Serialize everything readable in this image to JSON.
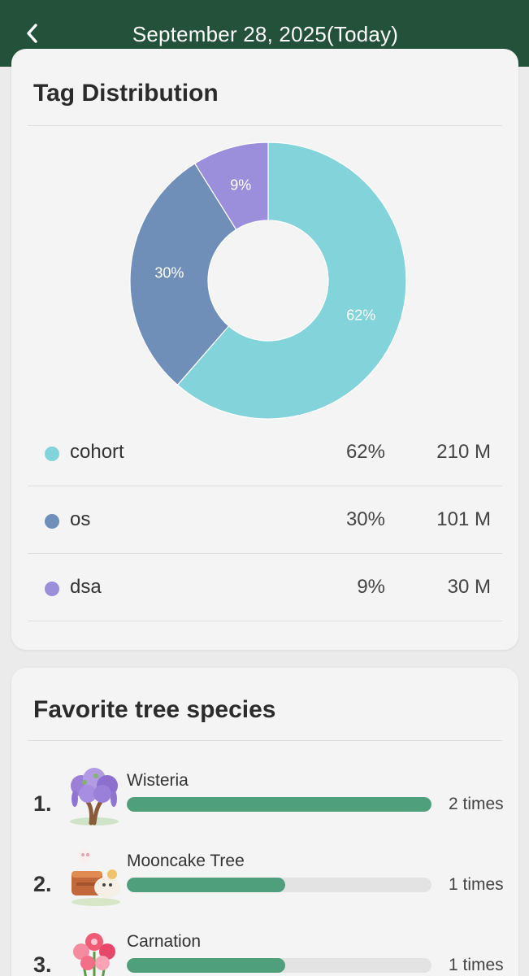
{
  "header": {
    "title": "September 28, 2025(Today)",
    "back_icon": "chevron-left-icon",
    "background": "#235139"
  },
  "tag_distribution": {
    "title": "Tag Distribution",
    "chart_data": {
      "type": "pie",
      "donut": true,
      "slices": [
        {
          "label": "cohort",
          "percent": 62,
          "display": "62%",
          "value": "210 M",
          "color": "#82d3da"
        },
        {
          "label": "os",
          "percent": 30,
          "display": "30%",
          "value": "101 M",
          "color": "#6f8fb9"
        },
        {
          "label": "dsa",
          "percent": 9,
          "display": "9%",
          "value": "30 M",
          "color": "#9b8edb"
        }
      ]
    }
  },
  "favorites": {
    "title": "Favorite tree species",
    "max_count": 2,
    "bar_color": "#4f9f7d",
    "items": [
      {
        "rank": "1.",
        "name": "Wisteria",
        "count": 2,
        "times": "2 times",
        "icon": "wisteria-tree-icon"
      },
      {
        "rank": "2.",
        "name": "Mooncake Tree",
        "count": 1,
        "times": "1 times",
        "icon": "mooncake-tree-icon"
      },
      {
        "rank": "3.",
        "name": "Carnation",
        "count": 1,
        "times": "1 times",
        "icon": "carnation-icon"
      }
    ]
  }
}
